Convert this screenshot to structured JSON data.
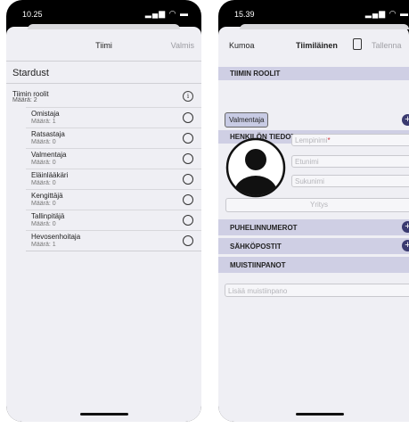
{
  "screen1": {
    "status_time": "10.25",
    "nav_title": "Tiimi",
    "nav_done": "Valmis",
    "team_name": "Stardust",
    "roles_title": "Tiimin roolit",
    "roles_count": "Määrä: 2",
    "roles": [
      {
        "name": "Omistaja",
        "count": "Määrä: 1"
      },
      {
        "name": "Ratsastaja",
        "count": "Määrä: 0"
      },
      {
        "name": "Valmentaja",
        "count": "Määrä: 0"
      },
      {
        "name": "Eläinlääkäri",
        "count": "Määrä: 0"
      },
      {
        "name": "Kengittäjä",
        "count": "Määrä: 0"
      },
      {
        "name": "Tallinpitäjä",
        "count": "Määrä: 0"
      },
      {
        "name": "Hevosenhoitaja",
        "count": "Määrä: 1"
      }
    ]
  },
  "screen2": {
    "status_time": "15.39",
    "nav_cancel": "Kumoa",
    "nav_title": "Tiimiläinen",
    "nav_save": "Tallenna",
    "section_roles": "TIIMIN ROOLIT",
    "role_chip": "Valmentaja",
    "section_person": "HENKILÖN TIEDOT",
    "nickname_placeholder": "Lempinimi",
    "required_mark": "*",
    "firstname_placeholder": "Etunimi",
    "lastname_placeholder": "Sukunimi",
    "company_placeholder": "Yritys",
    "section_phones": "PUHELINNUMEROT",
    "section_emails": "SÄHKÖPOSTIT",
    "section_notes": "MUISTIINPANOT",
    "notes_placeholder": "Lisää muistiinpano"
  },
  "colors": {
    "sheet_bg": "#efeff4",
    "section_bg": "#cfcfe4",
    "accent": "#3a3a70",
    "required": "#d0303a"
  }
}
